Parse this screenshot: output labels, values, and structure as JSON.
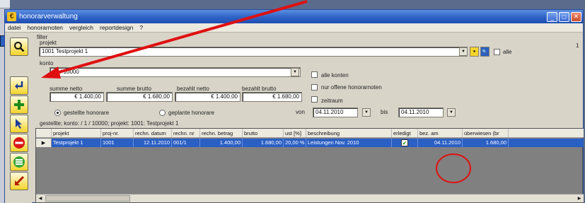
{
  "window": {
    "title": "honorarverwaltung",
    "app_icon": "€"
  },
  "menu": [
    "datei",
    "honorarnoten",
    "vergleich",
    "reportdesign",
    "?"
  ],
  "colors": {
    "titlebar": "#2f62c7",
    "selection": "#2a5fc4",
    "toolbar_button": "#f4d42a",
    "annotation": "#e01010"
  },
  "toolbar": [
    {
      "name": "search-icon",
      "glyph": "🔍"
    },
    {
      "name": "enter-icon",
      "glyph": "↵"
    },
    {
      "name": "add-icon",
      "glyph": "+"
    },
    {
      "name": "pointer-icon",
      "glyph": "➤"
    },
    {
      "name": "delete-icon",
      "glyph": "−"
    },
    {
      "name": "list-icon",
      "glyph": "≡"
    },
    {
      "name": "edit-icon",
      "glyph": "↙"
    }
  ],
  "filter": {
    "title": "filter",
    "page_number": "1",
    "projekt_label": "projekt",
    "projekt_value": "1001 Testprojekt 1",
    "alle_label": "alle",
    "konto_label": "konto",
    "konto_value": "/ 1 / 10000",
    "alle_konten_label": "alle konten",
    "nur_offene_label": "nur offene honorarnoten",
    "zeitraum_label": "zeitraum",
    "summe_netto_label": "summe netto",
    "summe_netto": "€ 1.400,00",
    "summe_brutto_label": "summe brutto",
    "summe_brutto": "€ 1.680,00",
    "bezahlt_netto_label": "bezahlt netto",
    "bezahlt_netto": "€ 1.400,00",
    "bezahlt_brutto_label": "bezahlt brutto",
    "bezahlt_brutto": "€ 1.680,00",
    "radio_gestellt": "gestellte honorare",
    "radio_geplant": "geplante honorare",
    "von_label": "von",
    "von_value": "04.11.2010",
    "bis_label": "bis",
    "bis_value": "04.11.2010"
  },
  "status_line": "gestellte; konto: / 1 / 10000; projekt: 1001: Testprojekt 1",
  "grid": {
    "columns": [
      "projekt",
      "proj-nr.",
      "rechn. datum",
      "rechn. nr",
      "rechn. betrag",
      "brutto",
      "ust [%]",
      "beschreibung",
      "erledigt",
      "bez. am",
      "überwiesen (br"
    ],
    "row": {
      "projekt": "Testprojekt 1",
      "proj_nr": "1001",
      "rechn_datum": "12.11.2010",
      "rechn_nr": "001/1",
      "rechn_betrag": "1.400,00",
      "brutto": "1.680,00",
      "ust": "20,00 %",
      "beschreibung": "Leistungen Nov. 2010",
      "erledigt": "✔",
      "bez_am": "04.11.2010",
      "ueberwiesen": "1.680,00"
    }
  }
}
